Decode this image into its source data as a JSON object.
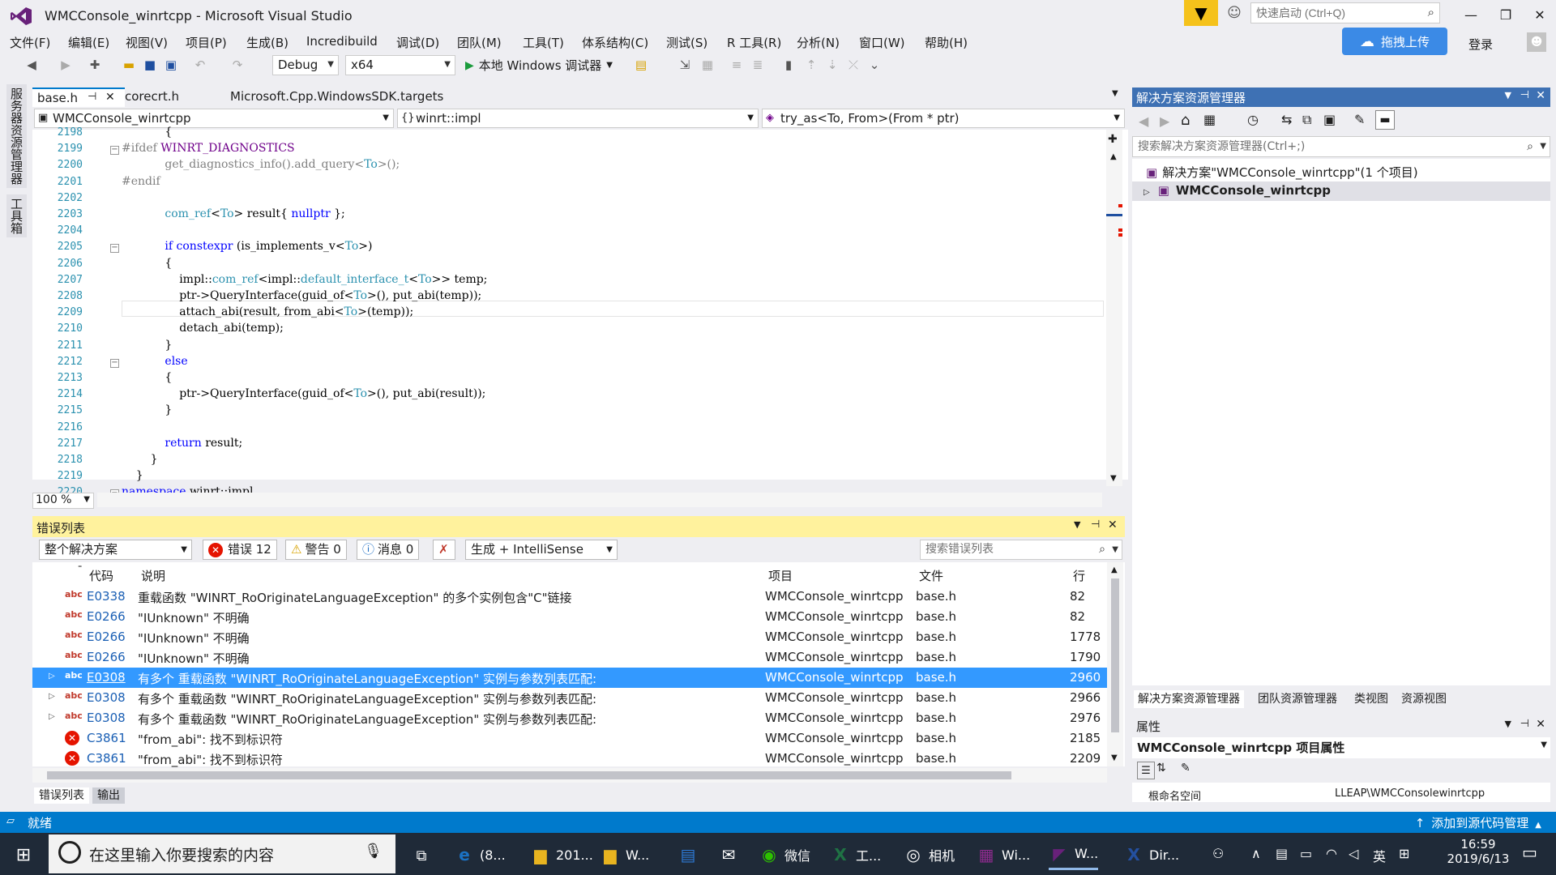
{
  "window": {
    "title": "WMCConsole_winrtcpp - Microsoft Visual Studio",
    "quick_launch_placeholder": "快速启动 (Ctrl+Q)"
  },
  "menu": [
    "文件(F)",
    "编辑(E)",
    "视图(V)",
    "项目(P)",
    "生成(B)",
    "Incredibuild",
    "调试(D)",
    "团队(M)",
    "工具(T)",
    "体系结构(C)",
    "测试(S)",
    "R 工具(R)",
    "分析(N)",
    "窗口(W)",
    "帮助(H)"
  ],
  "menu_x": [
    12,
    84,
    155,
    229,
    304,
    378,
    489,
    564,
    645,
    718,
    822,
    897,
    983,
    1060,
    1141
  ],
  "account": {
    "upload_label": "拖拽上传",
    "login_label": "登录"
  },
  "toolbar": {
    "config": "Debug",
    "platform": "x64",
    "run_label": "本地 Windows 调试器"
  },
  "left_strip": [
    "服务器资源管理器",
    "工具箱"
  ],
  "tabs": [
    "base.h",
    "corecrt.h",
    "Microsoft.Cpp.WindowsSDK.targets"
  ],
  "nav": {
    "project": "WMCConsole_winrtcpp",
    "scope": "winrt::impl",
    "member": "try_as<To, From>(From * ptr)"
  },
  "editor": {
    "zoom": "100 %"
  },
  "code_lines": [
    {
      "n": "2198",
      "t": "            {"
    },
    {
      "n": "2199",
      "t": "#ifdef WINRT_DIAGNOSTICS"
    },
    {
      "n": "2200",
      "t": "            get_diagnostics_info().add_query<To>();"
    },
    {
      "n": "2201",
      "t": "#endif"
    },
    {
      "n": "2202",
      "t": ""
    },
    {
      "n": "2203",
      "t": "            com_ref<To> result{ nullptr };"
    },
    {
      "n": "2204",
      "t": ""
    },
    {
      "n": "2205",
      "t": "            if constexpr (is_implements_v<To>)"
    },
    {
      "n": "2206",
      "t": "            {"
    },
    {
      "n": "2207",
      "t": "                impl::com_ref<impl::default_interface_t<To>> temp;"
    },
    {
      "n": "2208",
      "t": "                ptr->QueryInterface(guid_of<To>(), put_abi(temp));"
    },
    {
      "n": "2209",
      "t": "                attach_abi(result, from_abi<To>(temp));"
    },
    {
      "n": "2210",
      "t": "                detach_abi(temp);"
    },
    {
      "n": "2211",
      "t": "            }"
    },
    {
      "n": "2212",
      "t": "            else"
    },
    {
      "n": "2213",
      "t": "            {"
    },
    {
      "n": "2214",
      "t": "                ptr->QueryInterface(guid_of<To>(), put_abi(result));"
    },
    {
      "n": "2215",
      "t": "            }"
    },
    {
      "n": "2216",
      "t": ""
    },
    {
      "n": "2217",
      "t": "            return result;"
    },
    {
      "n": "2218",
      "t": "        }"
    },
    {
      "n": "2219",
      "t": "    }"
    },
    {
      "n": "2220",
      "t": "namespace winrt::impl"
    }
  ],
  "error_list": {
    "title": "错误列表",
    "scope": "整个解决方案",
    "errors_label": "错误 12",
    "warnings_label": "警告 0",
    "messages_label": "消息 0",
    "build_filter": "生成 + IntelliSense",
    "search_placeholder": "搜索错误列表",
    "headers": {
      "code": "代码",
      "desc": "说明",
      "project": "项目",
      "file": "文件",
      "line": "行"
    },
    "rows": [
      {
        "kind": "intellisense",
        "code": "E0338",
        "desc": "重载函数 \"WINRT_RoOriginateLanguageException\" 的多个实例包含\"C\"链接",
        "project": "WMCConsole_winrtcpp",
        "file": "base.h",
        "line": "82",
        "expandable": false,
        "selected": false
      },
      {
        "kind": "intellisense",
        "code": "E0266",
        "desc": "\"IUnknown\" 不明确",
        "project": "WMCConsole_winrtcpp",
        "file": "base.h",
        "line": "82",
        "expandable": false,
        "selected": false
      },
      {
        "kind": "intellisense",
        "code": "E0266",
        "desc": "\"IUnknown\" 不明确",
        "project": "WMCConsole_winrtcpp",
        "file": "base.h",
        "line": "1778",
        "expandable": false,
        "selected": false
      },
      {
        "kind": "intellisense",
        "code": "E0266",
        "desc": "\"IUnknown\" 不明确",
        "project": "WMCConsole_winrtcpp",
        "file": "base.h",
        "line": "1790",
        "expandable": false,
        "selected": false
      },
      {
        "kind": "intellisense",
        "code": "E0308",
        "desc": "有多个 重载函数 \"WINRT_RoOriginateLanguageException\" 实例与参数列表匹配:",
        "project": "WMCConsole_winrtcpp",
        "file": "base.h",
        "line": "2960",
        "expandable": true,
        "selected": true
      },
      {
        "kind": "intellisense",
        "code": "E0308",
        "desc": "有多个 重载函数 \"WINRT_RoOriginateLanguageException\" 实例与参数列表匹配:",
        "project": "WMCConsole_winrtcpp",
        "file": "base.h",
        "line": "2966",
        "expandable": true,
        "selected": false
      },
      {
        "kind": "intellisense",
        "code": "E0308",
        "desc": "有多个 重载函数 \"WINRT_RoOriginateLanguageException\" 实例与参数列表匹配:",
        "project": "WMCConsole_winrtcpp",
        "file": "base.h",
        "line": "2976",
        "expandable": true,
        "selected": false
      },
      {
        "kind": "build",
        "code": "C3861",
        "desc": "\"from_abi\": 找不到标识符",
        "project": "WMCConsole_winrtcpp",
        "file": "base.h",
        "line": "2185",
        "expandable": false,
        "selected": false
      },
      {
        "kind": "build",
        "code": "C3861",
        "desc": "\"from_abi\": 找不到标识符",
        "project": "WMCConsole_winrtcpp",
        "file": "base.h",
        "line": "2209",
        "expandable": false,
        "selected": false
      }
    ]
  },
  "bottom_tabs": [
    "错误列表",
    "输出"
  ],
  "solution_explorer": {
    "title": "解决方案资源管理器",
    "search_placeholder": "搜索解决方案资源管理器(Ctrl+;)",
    "solution_node": "解决方案\"WMCConsole_winrtcpp\"(1 个项目)",
    "project_node": "WMCConsole_winrtcpp",
    "tabs": [
      "解决方案资源管理器",
      "团队资源管理器",
      "类视图",
      "资源视图"
    ]
  },
  "properties": {
    "title": "属性",
    "object": "WMCConsole_winrtcpp 项目属性",
    "row_key": "根命名空间",
    "row_value": "LLEAP\\WMCConsolewinrtcpp"
  },
  "status": {
    "text": "就绪",
    "source_control": "添加到源代码管理"
  },
  "taskbar": {
    "search_placeholder": "在这里输入你要搜索的内容",
    "apps": [
      {
        "icon": "edge-icon",
        "label": "(8..."
      },
      {
        "icon": "folder-icon",
        "label": "201..."
      },
      {
        "icon": "folder-icon",
        "label": "W..."
      },
      {
        "icon": "store-icon",
        "label": ""
      },
      {
        "icon": "mail-icon",
        "label": ""
      },
      {
        "icon": "wechat-icon",
        "label": "微信"
      },
      {
        "icon": "excel-icon",
        "label": "工..."
      },
      {
        "icon": "camera-icon",
        "label": "相机"
      },
      {
        "icon": "winrar-icon",
        "label": "Wi..."
      },
      {
        "icon": "visual-studio-icon",
        "label": "W..."
      },
      {
        "icon": "dir-icon",
        "label": "Dir..."
      }
    ],
    "ime_label": "英",
    "time": "16:59",
    "date": "2019/6/13"
  },
  "colors": {
    "accent": "#007acc",
    "selection": "#3399ff",
    "error_header": "#fff29d",
    "error_red": "#e51400"
  }
}
